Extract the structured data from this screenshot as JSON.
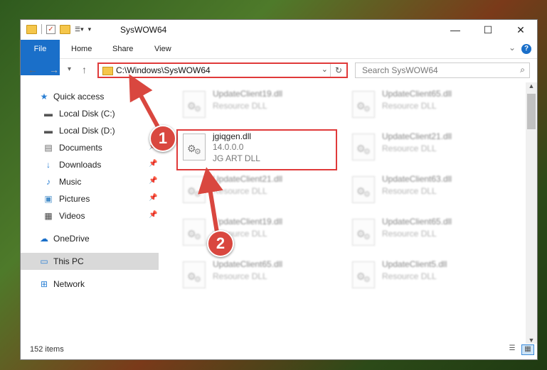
{
  "window": {
    "title": "SysWOW64",
    "controls": {
      "minimize": "—",
      "maximize": "☐",
      "close": "✕"
    }
  },
  "ribbon": {
    "tabs": [
      "File",
      "Home",
      "Share",
      "View"
    ],
    "help_label": "?"
  },
  "address": {
    "path": "C:\\Windows\\SysWOW64",
    "search_placeholder": "Search SysWOW64"
  },
  "sidebar": {
    "items": [
      {
        "label": "Quick access",
        "icon": "star-icon",
        "pinned": false
      },
      {
        "label": "Local Disk (C:)",
        "icon": "drive-icon",
        "pinned": false
      },
      {
        "label": "Local Disk (D:)",
        "icon": "drive-icon",
        "pinned": false
      },
      {
        "label": "Documents",
        "icon": "documents-icon",
        "pinned": true
      },
      {
        "label": "Downloads",
        "icon": "download-icon",
        "pinned": true
      },
      {
        "label": "Music",
        "icon": "music-icon",
        "pinned": true
      },
      {
        "label": "Pictures",
        "icon": "pictures-icon",
        "pinned": true
      },
      {
        "label": "Videos",
        "icon": "videos-icon",
        "pinned": true
      },
      {
        "label": "OneDrive",
        "icon": "cloud-icon",
        "pinned": false
      },
      {
        "label": "This PC",
        "icon": "computer-icon",
        "pinned": false,
        "selected": true
      },
      {
        "label": "Network",
        "icon": "network-icon",
        "pinned": false
      }
    ]
  },
  "files": {
    "featured": {
      "name": "jgiqgen.dll",
      "version": "14.0.0.0",
      "description": "JG ART DLL"
    },
    "blurred": [
      {
        "name": "UpdateClient19.dll",
        "description": "Resource DLL"
      },
      {
        "name": "UpdateClient65.dll",
        "description": "Resource DLL"
      },
      {
        "name": "UpdateClient21.dll",
        "description": "Resource DLL"
      },
      {
        "name": "UpdateClient21.dll",
        "description": "Resource DLL"
      },
      {
        "name": "UpdateClient63.dll",
        "description": "Resource DLL"
      },
      {
        "name": "UpdateClient19.dll",
        "description": "Resource DLL"
      },
      {
        "name": "UpdateClient65.dll",
        "description": "Resource DLL"
      },
      {
        "name": "UpdateClient65.dll",
        "description": "Resource DLL"
      },
      {
        "name": "UpdateClient5.dll",
        "description": "Resource DLL"
      }
    ]
  },
  "status": {
    "item_count": "152 items"
  },
  "callouts": {
    "first": "1",
    "second": "2"
  },
  "colors": {
    "accent": "#1a6fc9",
    "highlight": "#e03a3a",
    "callout": "#d9473f"
  }
}
